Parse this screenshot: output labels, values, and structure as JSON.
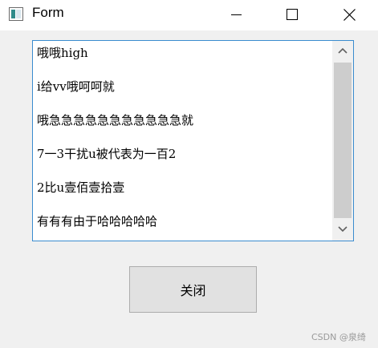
{
  "window": {
    "title": "Form",
    "icon": "app-window-icon"
  },
  "title_controls": {
    "minimize_icon": "minimize-icon",
    "maximize_icon": "maximize-icon",
    "close_icon": "close-icon"
  },
  "list": {
    "items": [
      "哦哦high",
      "i给vv哦呵呵就",
      "哦急急急急急急急急急急急就",
      "7一3干扰u被代表为一百2",
      "2比u壹佰壹拾壹",
      "有有有由于哈哈哈哈哈"
    ],
    "scroll_up_icon": "chevron-up-icon",
    "scroll_down_icon": "chevron-down-icon"
  },
  "buttons": {
    "close_label": "关闭"
  },
  "watermark": "CSDN @泉绮",
  "colors": {
    "list_border": "#3a8ccf",
    "titlebar": "#ffffff",
    "window_bg": "#f0f0f0",
    "button_bg": "#e1e1e1",
    "scroll_thumb": "#cdcdcd"
  }
}
